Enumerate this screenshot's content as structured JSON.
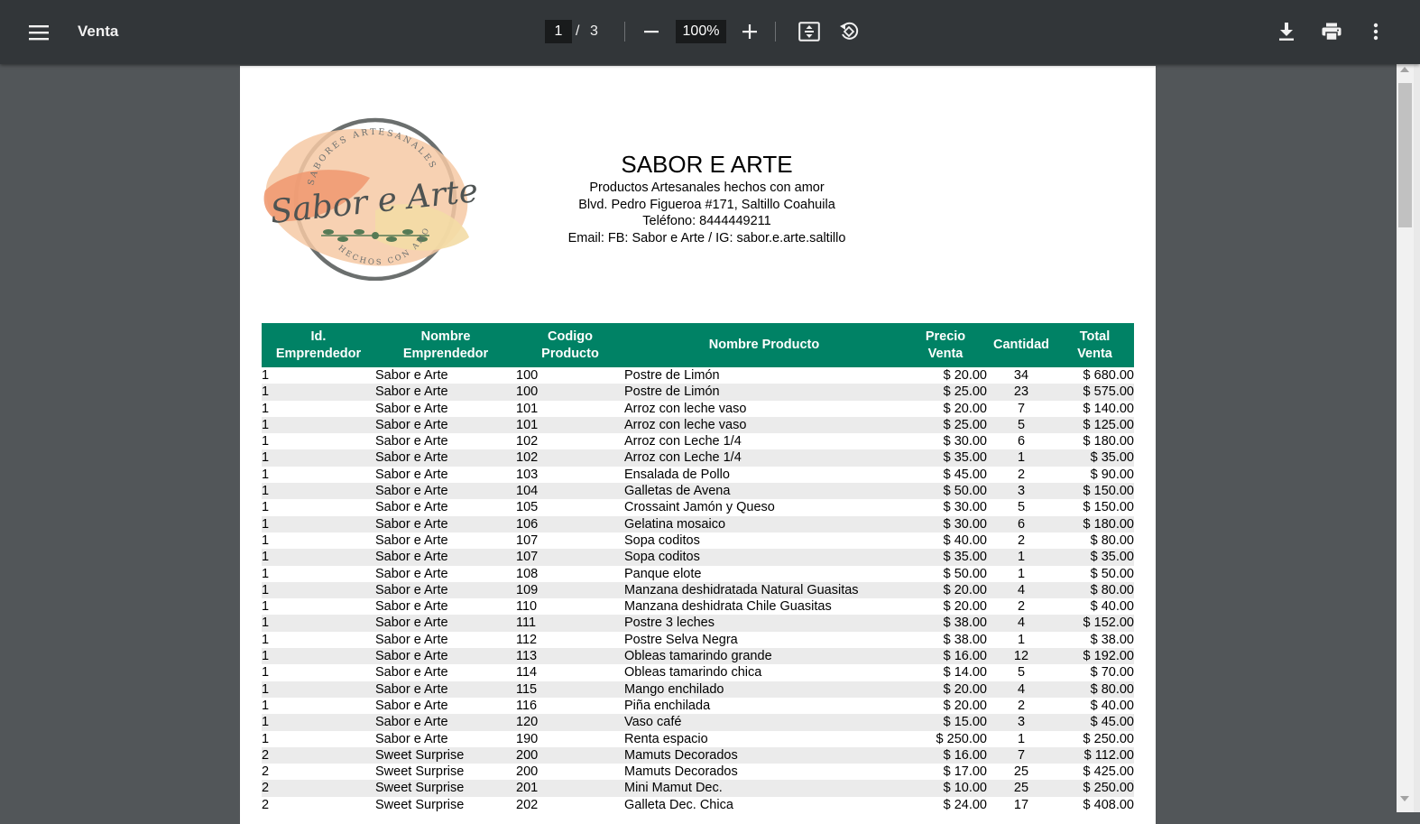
{
  "toolbar": {
    "title": "Venta",
    "page_current": "1",
    "page_separator": "/",
    "page_total": "3",
    "zoom": "100%"
  },
  "icons": {
    "menu": "menu-icon",
    "zoom_out": "minus-icon",
    "zoom_in": "plus-icon",
    "fit": "fit-to-page-icon",
    "rotate": "rotate-icon",
    "download": "download-icon",
    "print": "print-icon",
    "more": "more-vert-icon"
  },
  "document": {
    "logo": {
      "arc_top": "SABORES ARTESANALES",
      "script": "Sabor e Arte",
      "arc_bottom": "HECHOS CON AMOR"
    },
    "company": "SABOR E ARTE",
    "tagline": "Productos Artesanales hechos con amor",
    "address": "Blvd. Pedro Figueroa #171, Saltillo Coahuila",
    "phone": "Teléfono: 8444449211",
    "email": "Email: FB: Sabor e Arte / IG: sabor.e.arte.saltillo",
    "table": {
      "headers": [
        [
          "Id.",
          "Emprendedor"
        ],
        [
          "Nombre",
          "Emprendedor"
        ],
        [
          "Codigo",
          "Producto"
        ],
        [
          "Nombre Producto"
        ],
        [
          "Precio",
          "Venta"
        ],
        [
          "Cantidad"
        ],
        [
          "Total",
          "Venta"
        ]
      ],
      "rows": [
        [
          "1",
          "Sabor e Arte",
          "100",
          "Postre de Limón",
          "$ 20.00",
          "34",
          "$ 680.00"
        ],
        [
          "1",
          "Sabor e Arte",
          "100",
          "Postre de Limón",
          "$ 25.00",
          "23",
          "$ 575.00"
        ],
        [
          "1",
          "Sabor e Arte",
          "101",
          "Arroz con leche vaso",
          "$ 20.00",
          "7",
          "$ 140.00"
        ],
        [
          "1",
          "Sabor e Arte",
          "101",
          "Arroz con leche vaso",
          "$ 25.00",
          "5",
          "$ 125.00"
        ],
        [
          "1",
          "Sabor e Arte",
          "102",
          "Arroz con Leche 1/4",
          "$ 30.00",
          "6",
          "$ 180.00"
        ],
        [
          "1",
          "Sabor e Arte",
          "102",
          "Arroz con Leche 1/4",
          "$ 35.00",
          "1",
          "$ 35.00"
        ],
        [
          "1",
          "Sabor e Arte",
          "103",
          "Ensalada de Pollo",
          "$ 45.00",
          "2",
          "$ 90.00"
        ],
        [
          "1",
          "Sabor e Arte",
          "104",
          "Galletas de Avena",
          "$ 50.00",
          "3",
          "$ 150.00"
        ],
        [
          "1",
          "Sabor e Arte",
          "105",
          "Crossaint Jamón y Queso",
          "$ 30.00",
          "5",
          "$ 150.00"
        ],
        [
          "1",
          "Sabor e Arte",
          "106",
          "Gelatina mosaico",
          "$ 30.00",
          "6",
          "$ 180.00"
        ],
        [
          "1",
          "Sabor e Arte",
          "107",
          "Sopa coditos",
          "$ 40.00",
          "2",
          "$ 80.00"
        ],
        [
          "1",
          "Sabor e Arte",
          "107",
          "Sopa coditos",
          "$ 35.00",
          "1",
          "$ 35.00"
        ],
        [
          "1",
          "Sabor e Arte",
          "108",
          "Panque elote",
          "$ 50.00",
          "1",
          "$ 50.00"
        ],
        [
          "1",
          "Sabor e Arte",
          "109",
          "Manzana deshidratada Natural Guasitas",
          "$ 20.00",
          "4",
          "$ 80.00"
        ],
        [
          "1",
          "Sabor e Arte",
          "110",
          "Manzana deshidrata Chile Guasitas",
          "$ 20.00",
          "2",
          "$ 40.00"
        ],
        [
          "1",
          "Sabor e Arte",
          "111",
          "Postre 3 leches",
          "$ 38.00",
          "4",
          "$ 152.00"
        ],
        [
          "1",
          "Sabor e Arte",
          "112",
          "Postre Selva Negra",
          "$ 38.00",
          "1",
          "$ 38.00"
        ],
        [
          "1",
          "Sabor e Arte",
          "113",
          "Obleas tamarindo grande",
          "$ 16.00",
          "12",
          "$ 192.00"
        ],
        [
          "1",
          "Sabor e Arte",
          "114",
          "Obleas tamarindo chica",
          "$ 14.00",
          "5",
          "$ 70.00"
        ],
        [
          "1",
          "Sabor e Arte",
          "115",
          "Mango enchilado",
          "$ 20.00",
          "4",
          "$ 80.00"
        ],
        [
          "1",
          "Sabor e Arte",
          "116",
          "Piña enchilada",
          "$ 20.00",
          "2",
          "$ 40.00"
        ],
        [
          "1",
          "Sabor e Arte",
          "120",
          "Vaso café",
          "$ 15.00",
          "3",
          "$ 45.00"
        ],
        [
          "1",
          "Sabor e Arte",
          "190",
          "Renta espacio",
          "$ 250.00",
          "1",
          "$ 250.00"
        ],
        [
          "2",
          "Sweet Surprise",
          "200",
          "Mamuts Decorados",
          "$ 16.00",
          "7",
          "$ 112.00"
        ],
        [
          "2",
          "Sweet Surprise",
          "200",
          "Mamuts Decorados",
          "$ 17.00",
          "25",
          "$ 425.00"
        ],
        [
          "2",
          "Sweet Surprise",
          "201",
          "Mini Mamut Dec.",
          "$ 10.00",
          "25",
          "$ 250.00"
        ],
        [
          "2",
          "Sweet Surprise",
          "202",
          "Galleta Dec. Chica",
          "$ 24.00",
          "17",
          "$ 408.00"
        ]
      ]
    }
  },
  "colors": {
    "toolbar_bg": "#323639",
    "viewer_bg": "#525659",
    "table_header": "#008265",
    "row_stripe": "#ebebeb"
  }
}
